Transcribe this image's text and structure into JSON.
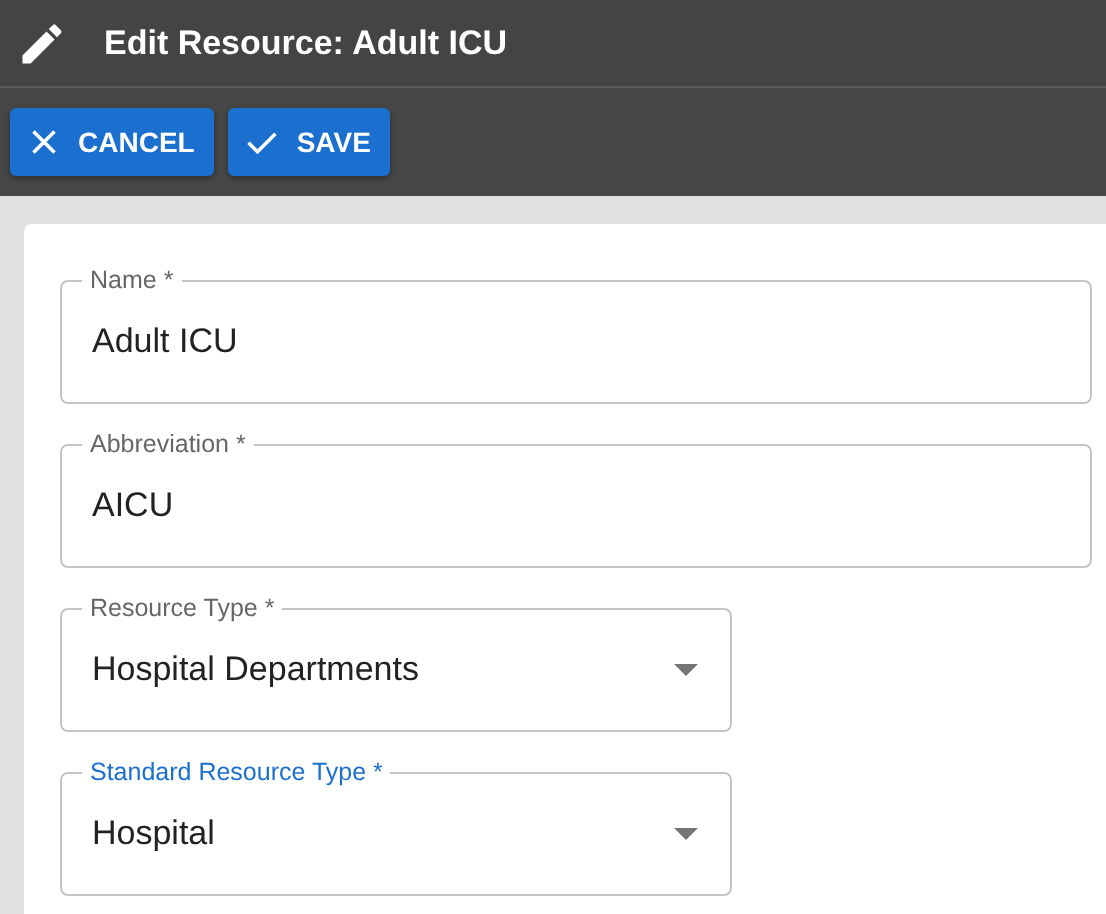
{
  "header": {
    "title": "Edit Resource: Adult ICU"
  },
  "toolbar": {
    "buttons": [
      {
        "label": "CANCEL",
        "kind": "cancel"
      },
      {
        "label": "SAVE",
        "kind": "save"
      }
    ]
  },
  "form": {
    "fields": [
      {
        "label": "Name *",
        "value": "Adult ICU",
        "kind": "text",
        "focused": false
      },
      {
        "label": "Abbreviation *",
        "value": "AICU",
        "kind": "text",
        "focused": false
      },
      {
        "label": "Resource Type *",
        "value": "Hospital Departments",
        "kind": "select",
        "focused": false
      },
      {
        "label": "Standard Resource Type *",
        "value": "Hospital",
        "kind": "select",
        "focused": true
      }
    ]
  }
}
